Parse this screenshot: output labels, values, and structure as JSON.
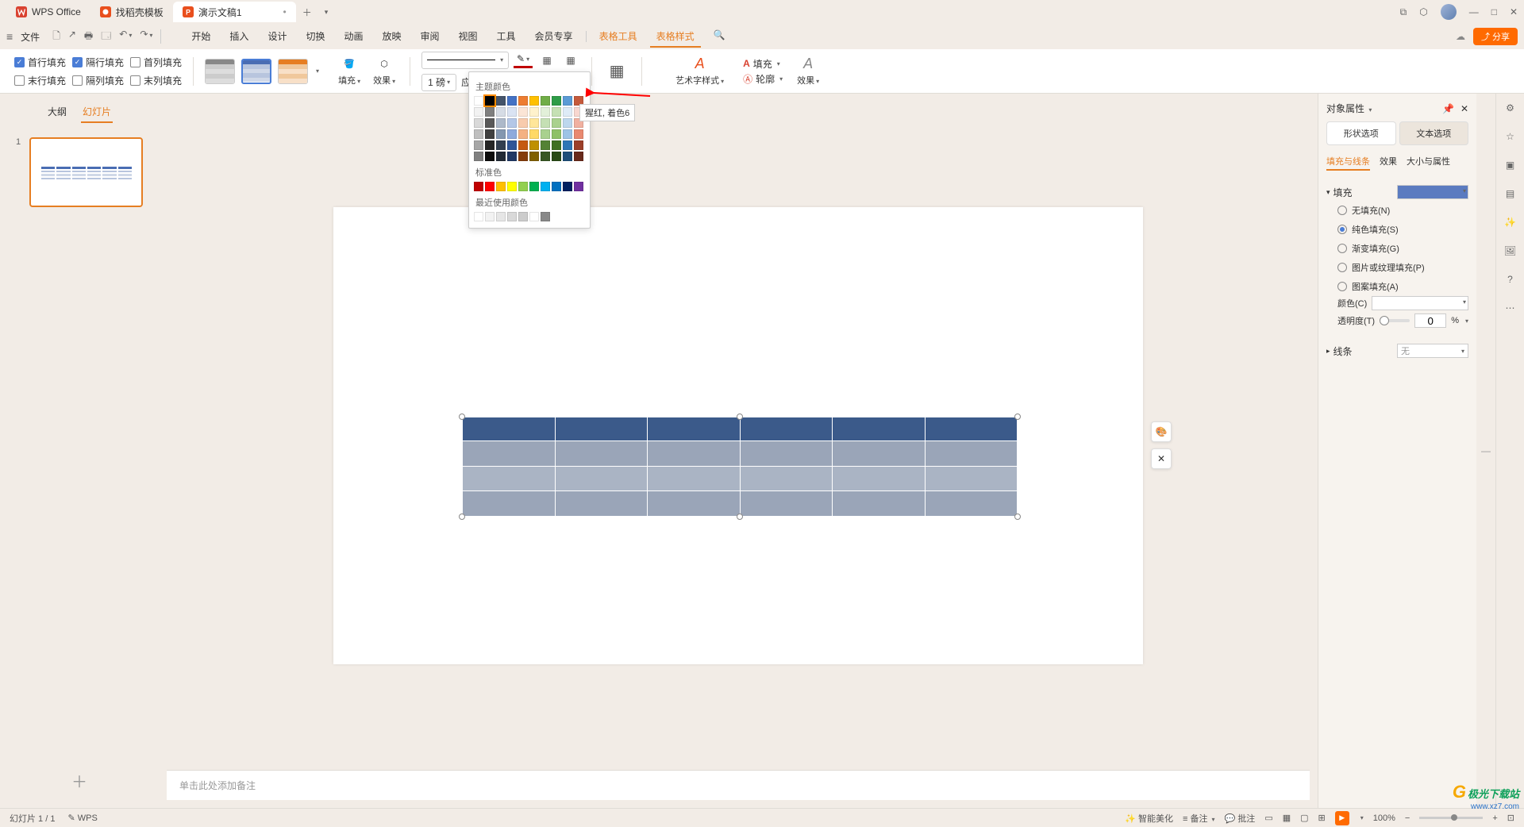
{
  "titlebar": {
    "app": "WPS Office",
    "tabs": [
      {
        "label": "找稻壳模板"
      },
      {
        "label": "演示文稿1"
      }
    ]
  },
  "menu": {
    "file": "文件",
    "tabs": [
      "开始",
      "插入",
      "设计",
      "切换",
      "动画",
      "放映",
      "审阅",
      "视图",
      "工具",
      "会员专享"
    ],
    "orange_tabs": [
      "表格工具",
      "表格样式"
    ]
  },
  "ribbon": {
    "chk_header_row": "首行填充",
    "chk_banded_row": "隔行填充",
    "chk_first_col": "首列填充",
    "chk_total_row": "末行填充",
    "chk_banded_col": "隔列填充",
    "chk_last_col": "末列填充",
    "fill_btn": "填充",
    "effect_btn": "效果",
    "weight": "1 磅",
    "apply_to": "应用至：",
    "art_style": "艺术字样式",
    "text_fill": "填充",
    "text_outline": "轮廓",
    "text_effect": "效果"
  },
  "color_picker": {
    "theme": "主题颜色",
    "standard": "标准色",
    "recent": "最近使用颜色",
    "tooltip": "猩红, 着色6"
  },
  "slide_pane": {
    "outline": "大纲",
    "slides": "幻灯片",
    "num": "1"
  },
  "notes": "单击此处添加备注",
  "panel": {
    "title": "对象属性",
    "shape_tab": "形状选项",
    "text_tab": "文本选项",
    "sub_fill": "填充与线条",
    "sub_effect": "效果",
    "sub_size": "大小与属性",
    "fill_section": "填充",
    "no_fill": "无填充(N)",
    "solid_fill": "纯色填充(S)",
    "gradient_fill": "渐变填充(G)",
    "picture_fill": "图片或纹理填充(P)",
    "pattern_fill": "图案填充(A)",
    "color_label": "颜色(C)",
    "trans_label": "透明度(T)",
    "trans_val": "0",
    "pct": "%",
    "line_section": "线条",
    "line_none": "无"
  },
  "status": {
    "slide_count": "幻灯片 1 / 1",
    "wps": "WPS",
    "ai": "智能美化",
    "notes_btn": "备注",
    "comments": "批注",
    "zoom": "100%"
  },
  "share": "分享",
  "watermark": {
    "t1": "极光下载站",
    "t2": "www.xz7.com"
  }
}
